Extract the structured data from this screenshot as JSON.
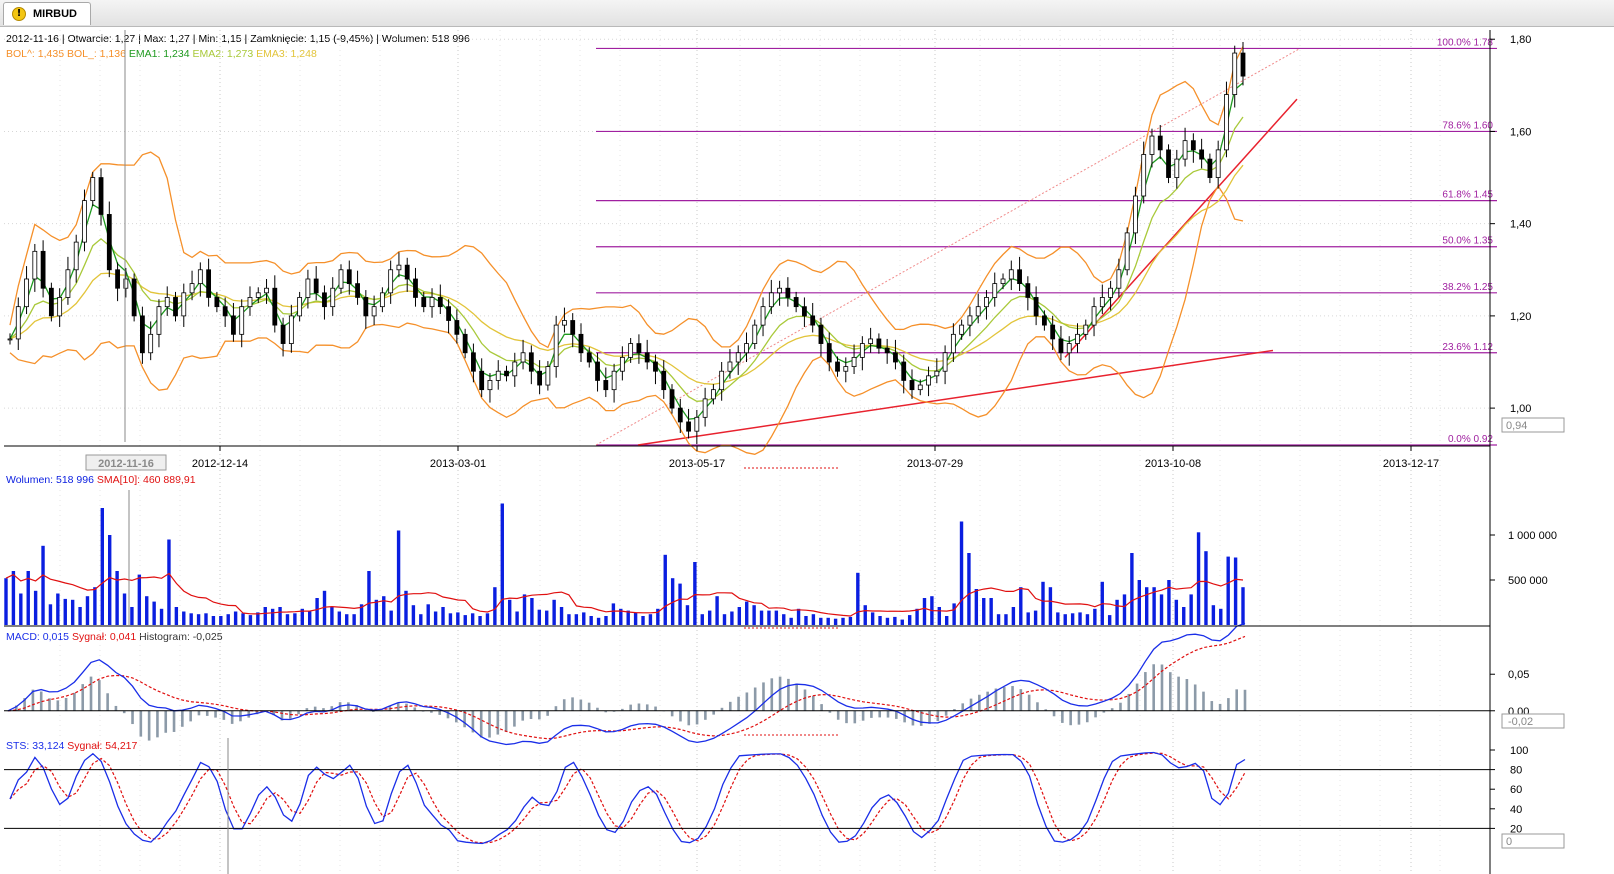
{
  "tab": {
    "label": "MIRBUD",
    "icon": "warning-icon"
  },
  "header": {
    "date": "2012-11-16",
    "open": "Otwarcie: 1,27",
    "max": "Max: 1,27",
    "min": "Min: 1,15",
    "close": "Zamknięcie: 1,15 (-9,45%)",
    "volume": "Wolumen: 518 996",
    "bol_up": "BOL^: 1,435",
    "bol_down": "BOL_: 1,136",
    "ema1": "EMA1: 1,234",
    "ema2": "EMA2: 1,273",
    "ema3": "EMA3: 1,248",
    "crosshair_date": "2012-11-16",
    "last_price_box": "0,94"
  },
  "volume_header": {
    "volume": "Wolumen: 518 996",
    "sma": "SMA[10]: 460 889,91"
  },
  "macd_header": {
    "macd": "MACD: 0,015",
    "signal": "Sygnał: 0,041",
    "histogram": "Histogram: -0,025",
    "last_box": "-0,02"
  },
  "sts_header": {
    "sts": "STS: 33,124",
    "signal": "Sygnał: 54,217",
    "last_box": "0"
  },
  "colors": {
    "up_color": "#2e7d32",
    "candle": "#000000",
    "bollinger": "#f5902a",
    "ema1": "#1f9a1f",
    "ema2": "#a9c93a",
    "ema3": "#e2c43a",
    "fib": "#a020a0",
    "trend": "#e8222e",
    "volume": "#0a1ee0",
    "sma": "#e01010",
    "macd": "#1a2ee8",
    "signal": "#e01010",
    "histogram": "#8c9aa8",
    "sts": "#1a2ee8"
  },
  "chart_data": [
    {
      "type": "candlestick",
      "panel": "price",
      "x_tick_labels": [
        "2012-12-14",
        "2013-03-01",
        "2013-05-17",
        "2013-07-29",
        "2013-10-08",
        "2013-12-17"
      ],
      "y_tick_labels": [
        "1,80",
        "1,60",
        "1,40",
        "1,20",
        "1,00"
      ],
      "ylim": [
        0.92,
        1.82
      ],
      "series": [
        {
          "name": "Close (approx.)",
          "values": [
            1.15,
            1.22,
            1.28,
            1.34,
            1.26,
            1.2,
            1.24,
            1.3,
            1.36,
            1.45,
            1.5,
            1.42,
            1.3,
            1.26,
            1.28,
            1.2,
            1.12,
            1.16,
            1.22,
            1.24,
            1.2,
            1.25,
            1.27,
            1.3,
            1.24,
            1.22,
            1.2,
            1.16,
            1.22,
            1.24,
            1.25,
            1.26,
            1.18,
            1.14,
            1.2,
            1.24,
            1.28,
            1.25,
            1.22,
            1.26,
            1.3,
            1.27,
            1.24,
            1.2,
            1.22,
            1.25,
            1.3,
            1.31,
            1.28,
            1.24,
            1.22,
            1.24,
            1.22,
            1.19,
            1.16,
            1.12,
            1.08,
            1.04,
            1.06,
            1.08,
            1.07,
            1.1,
            1.12,
            1.08,
            1.05,
            1.09,
            1.18,
            1.19,
            1.16,
            1.12,
            1.1,
            1.06,
            1.04,
            1.08,
            1.11,
            1.14,
            1.12,
            1.1,
            1.08,
            1.04,
            1.0,
            0.97,
            0.95,
            0.98,
            1.02,
            1.04,
            1.08,
            1.1,
            1.12,
            1.14,
            1.18,
            1.22,
            1.25,
            1.26,
            1.24,
            1.22,
            1.2,
            1.18,
            1.14,
            1.1,
            1.08,
            1.09,
            1.11,
            1.14,
            1.15,
            1.13,
            1.12,
            1.1,
            1.06,
            1.04,
            1.05,
            1.07,
            1.08,
            1.12,
            1.16,
            1.18,
            1.2,
            1.22,
            1.24,
            1.27,
            1.28,
            1.3,
            1.27,
            1.24,
            1.2,
            1.18,
            1.15,
            1.12,
            1.14,
            1.16,
            1.18,
            1.22,
            1.24,
            1.26,
            1.3,
            1.38,
            1.46,
            1.55,
            1.59,
            1.56,
            1.5,
            1.54,
            1.58,
            1.56,
            1.54,
            1.5,
            1.56,
            1.68,
            1.77,
            1.72
          ]
        },
        {
          "name": "EMA1",
          "value_last": 1.234
        },
        {
          "name": "EMA2",
          "value_last": 1.273
        },
        {
          "name": "EMA3",
          "value_last": 1.248
        },
        {
          "name": "BOL^",
          "value_last": 1.435
        },
        {
          "name": "BOL_",
          "value_last": 1.136
        }
      ],
      "fibonacci_levels": [
        {
          "label": "100.0% 1.78",
          "value": 1.78
        },
        {
          "label": "78.6% 1.60",
          "value": 1.6
        },
        {
          "label": "61.8% 1.45",
          "value": 1.45
        },
        {
          "label": "50.0% 1.35",
          "value": 1.35
        },
        {
          "label": "38.2% 1.25",
          "value": 1.25
        },
        {
          "label": "23.6% 1.12",
          "value": 1.12
        },
        {
          "label": "0.0% 0.92",
          "value": 0.92
        }
      ]
    },
    {
      "type": "bar",
      "panel": "volume",
      "y_tick_labels": [
        "1 000 000",
        "500 000"
      ],
      "ylim": [
        0,
        1500000
      ],
      "series": [
        {
          "name": "Wolumen",
          "values": [
            520000,
            600000,
            350000,
            600000,
            380000,
            880000,
            230000,
            350000,
            290000,
            280000,
            200000,
            320000,
            420000,
            1300000,
            1000000,
            600000,
            350000,
            200000,
            560000,
            320000,
            260000,
            180000,
            950000,
            200000,
            150000,
            130000,
            120000,
            130000,
            100000,
            100000,
            120000,
            150000,
            130000,
            110000,
            140000,
            200000,
            180000,
            200000,
            120000,
            130000,
            180000,
            150000,
            300000,
            380000,
            200000,
            150000,
            120000,
            120000,
            230000,
            600000,
            280000,
            320000,
            160000,
            1050000,
            380000,
            220000,
            120000,
            230000,
            150000,
            200000,
            130000,
            140000,
            110000,
            130000,
            100000,
            130000,
            420000,
            1350000,
            280000,
            150000,
            340000,
            300000,
            170000,
            160000,
            280000,
            200000,
            120000,
            120000,
            140000,
            100000,
            80000,
            100000,
            240000,
            180000,
            160000,
            140000,
            100000,
            120000,
            180000,
            780000,
            520000,
            460000,
            220000,
            700000,
            120000,
            160000,
            320000,
            120000,
            150000,
            200000,
            260000,
            220000,
            160000,
            160000,
            160000,
            120000,
            80000,
            180000,
            100000,
            120000,
            80000,
            80000,
            70000,
            80000,
            90000,
            580000,
            220000,
            140000,
            100000,
            80000,
            90000,
            60000,
            110000,
            180000,
            300000,
            320000,
            200000,
            100000,
            240000,
            1150000,
            800000,
            400000,
            300000,
            300000,
            120000,
            120000,
            200000,
            420000,
            140000,
            160000,
            480000,
            420000,
            140000,
            120000,
            130000,
            140000,
            120000,
            180000,
            480000,
            110000,
            280000,
            340000,
            800000,
            500000,
            420000,
            420000,
            340000,
            500000,
            280000,
            200000,
            340000,
            1030000,
            820000,
            220000,
            180000,
            760000,
            750000,
            420000
          ]
        },
        {
          "name": "SMA[10]",
          "value_last": 460889.91
        }
      ]
    },
    {
      "type": "line",
      "panel": "macd",
      "y_tick_labels": [
        "0,05",
        "0,00"
      ],
      "ylim": [
        -0.04,
        0.09
      ],
      "series": [
        {
          "name": "MACD",
          "value_last": 0.015
        },
        {
          "name": "Sygnał",
          "value_last": 0.041
        },
        {
          "name": "Histogram",
          "value_last": -0.025
        }
      ]
    },
    {
      "type": "line",
      "panel": "sts",
      "y_tick_labels": [
        "100",
        "80",
        "60",
        "40",
        "20"
      ],
      "ylim": [
        0,
        100
      ],
      "series": [
        {
          "name": "STS",
          "value_last": 33.124
        },
        {
          "name": "Sygnał",
          "value_last": 54.217
        }
      ]
    }
  ]
}
